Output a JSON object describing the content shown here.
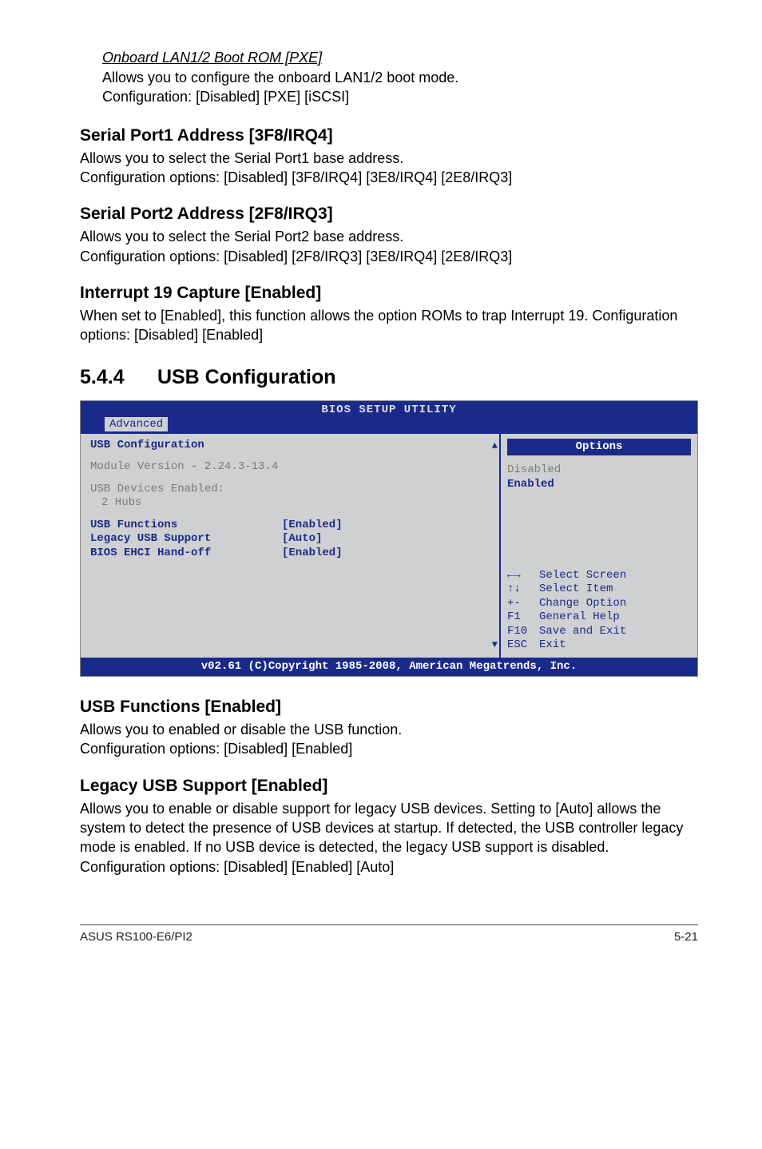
{
  "top": {
    "sub_heading": "Onboard LAN1/2 Boot ROM [PXE]",
    "sub_line1": "Allows you to configure the onboard LAN1/2 boot mode.",
    "sub_line2": "Configuration: [Disabled] [PXE] [iSCSI]"
  },
  "s1": {
    "heading": "Serial Port1 Address [3F8/IRQ4]",
    "l1": "Allows you to select the Serial Port1 base address.",
    "l2": "Configuration options: [Disabled] [3F8/IRQ4] [3E8/IRQ4] [2E8/IRQ3]"
  },
  "s2": {
    "heading": "Serial Port2 Address [2F8/IRQ3]",
    "l1": "Allows you to select the Serial Port2 base address.",
    "l2": "Configuration options: [Disabled] [2F8/IRQ3] [3E8/IRQ4] [2E8/IRQ3]"
  },
  "s3": {
    "heading": "Interrupt 19 Capture [Enabled]",
    "l1": "When set to [Enabled], this function allows the option ROMs to trap Interrupt 19. Configuration options: [Disabled] [Enabled]"
  },
  "h2": {
    "num": "5.4.4",
    "title": "USB Configuration"
  },
  "bios": {
    "title": "BIOS SETUP UTILITY",
    "tab": "Advanced",
    "section": "USB Configuration",
    "module": "Module Version - 2.24.3-13.4",
    "devices_label": "USB Devices Enabled:",
    "devices_val": "2 Hubs",
    "row1_label": "USB Functions",
    "row1_val": "[Enabled]",
    "row2_label": "Legacy USB Support",
    "row2_val": "[Auto]",
    "row3_label": "BIOS EHCI Hand-off",
    "row3_val": "[Enabled]",
    "options_title": "Options",
    "opt1": "Disabled",
    "opt2": "Enabled",
    "help": {
      "k1": "←→",
      "v1": "Select Screen",
      "k2": "↑↓",
      "v2": "Select Item",
      "k3": "+-",
      "v3": "Change Option",
      "k4": "F1",
      "v4": "General Help",
      "k5": "F10",
      "v5": "Save and Exit",
      "k6": "ESC",
      "v6": "Exit"
    },
    "footer": "v02.61 (C)Copyright 1985-2008, American Megatrends, Inc."
  },
  "s4": {
    "heading": "USB Functions [Enabled]",
    "l1": "Allows you to enabled or disable the USB function.",
    "l2": "Configuration options: [Disabled] [Enabled]"
  },
  "s5": {
    "heading": "Legacy USB Support [Enabled]",
    "l1": "Allows you to enable or disable support for legacy USB devices. Setting to [Auto] allows the system to detect the presence of USB devices at startup. If detected, the USB controller legacy mode is enabled. If no USB device is detected, the legacy USB support is disabled. Configuration options: [Disabled] [Enabled] [Auto]"
  },
  "footer": {
    "left": "ASUS RS100-E6/PI2",
    "right": "5-21"
  }
}
